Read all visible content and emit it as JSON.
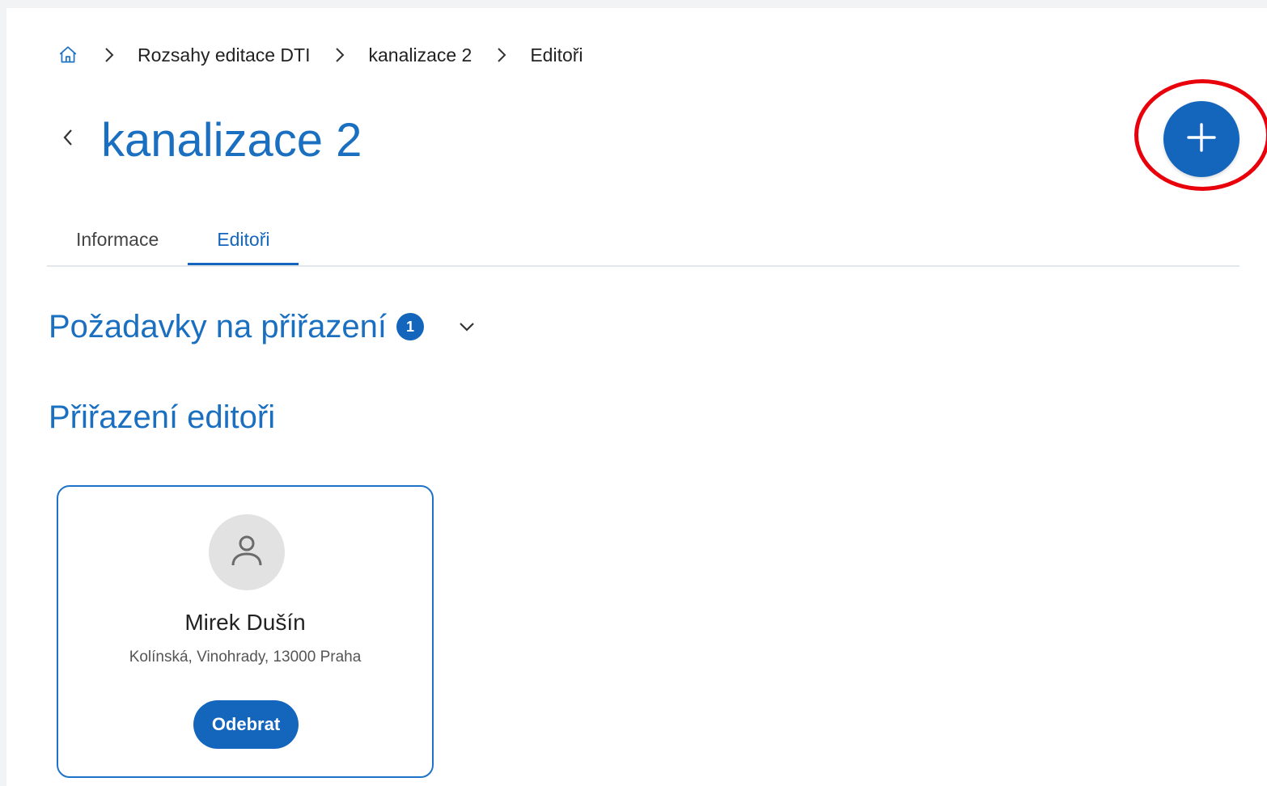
{
  "breadcrumb": {
    "home_icon": "home-icon",
    "separator_icon": "chevron-right-icon",
    "items": [
      "Rozsahy editace DTI",
      "kanalizace 2",
      "Editoři"
    ]
  },
  "header": {
    "back_icon": "chevron-left-icon",
    "title": "kanalizace 2",
    "add_icon": "plus-icon"
  },
  "tabs": [
    {
      "label": "Informace",
      "active": false
    },
    {
      "label": "Editoři",
      "active": true
    }
  ],
  "requests_section": {
    "title": "Požadavky na přiřazení",
    "count": "1",
    "toggle_icon": "chevron-down-icon"
  },
  "assigned_section": {
    "title": "Přiřazení editoři"
  },
  "editors": [
    {
      "avatar_icon": "user-icon",
      "name": "Mirek Dušín",
      "address": "Kolínská, Vinohrady, 13000 Praha",
      "remove_label": "Odebrat"
    }
  ],
  "colors": {
    "primary": "#1466bc",
    "title_blue": "#1a6fc0",
    "highlight": "#e8000b"
  }
}
